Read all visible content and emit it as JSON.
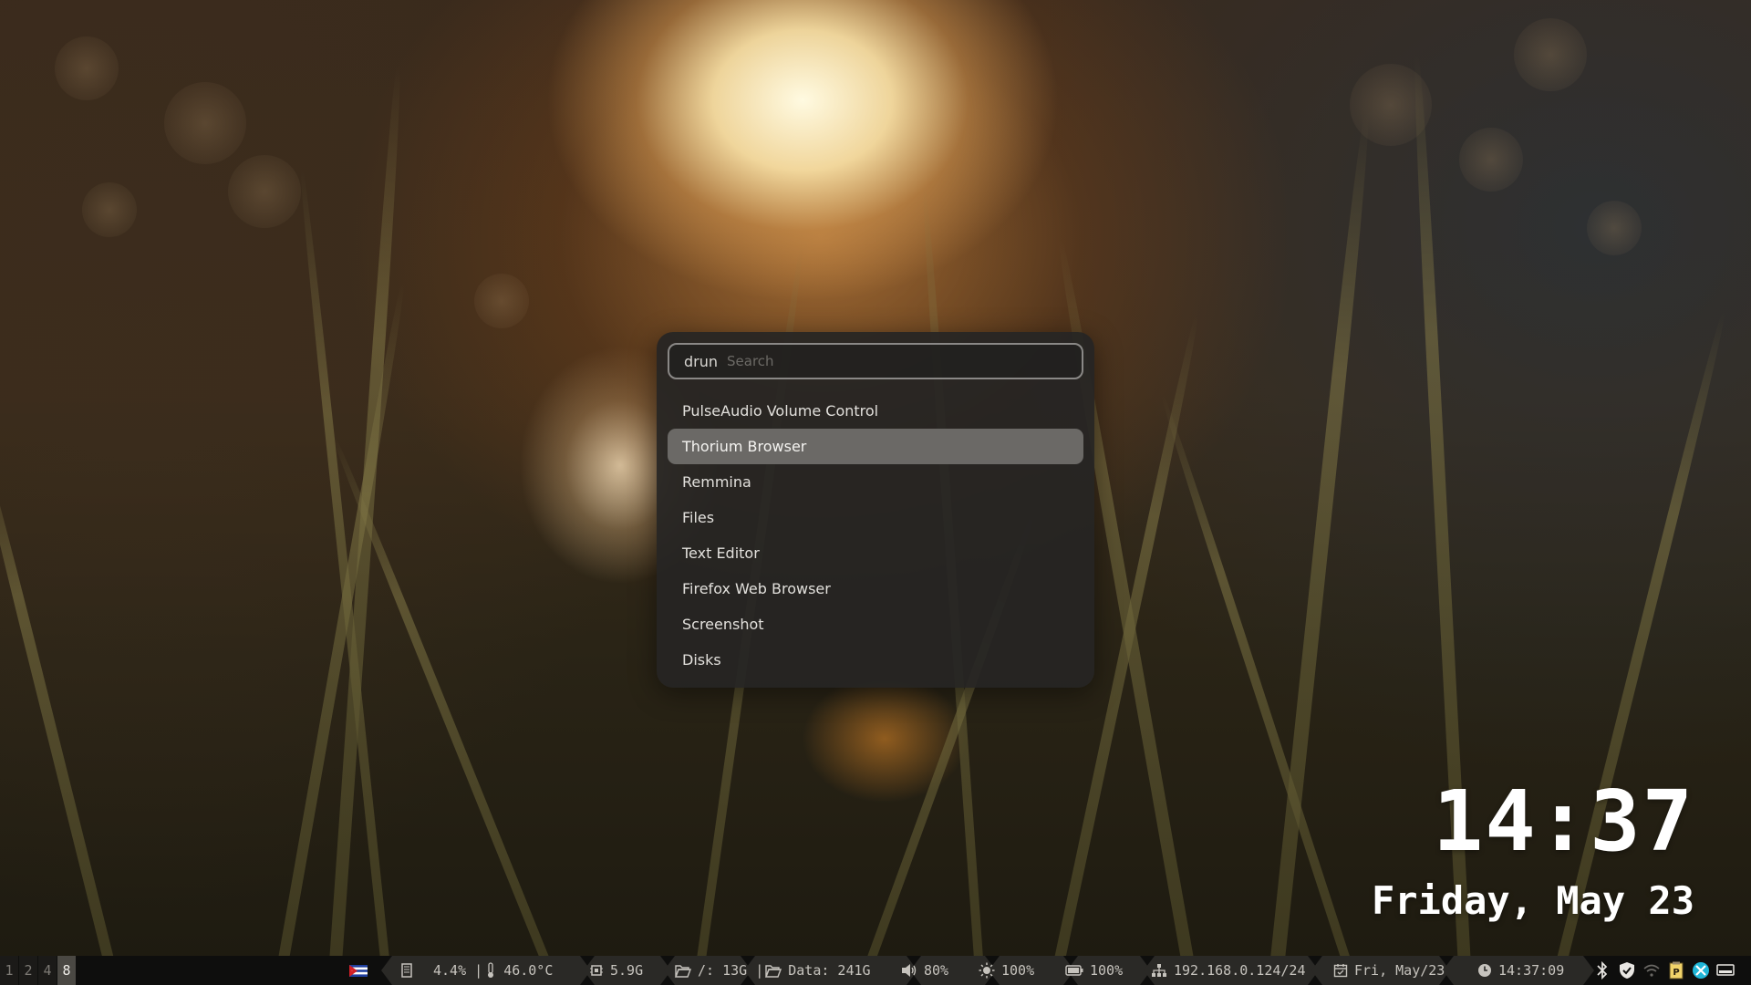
{
  "launcher": {
    "mode": "drun",
    "search_placeholder": "Search",
    "search_value": "",
    "selected_index": 1,
    "items": [
      {
        "label": "PulseAudio Volume Control"
      },
      {
        "label": "Thorium Browser"
      },
      {
        "label": "Remmina"
      },
      {
        "label": "Files"
      },
      {
        "label": "Text Editor"
      },
      {
        "label": "Firefox Web Browser"
      },
      {
        "label": "Screenshot"
      },
      {
        "label": "Disks"
      }
    ]
  },
  "desktop_clock": {
    "time": "14:37",
    "date": "Friday, May 23"
  },
  "bar": {
    "workspaces": [
      {
        "label": "1",
        "active": false
      },
      {
        "label": "2",
        "active": false
      },
      {
        "label": "4",
        "active": false
      },
      {
        "label": "8",
        "active": true
      }
    ],
    "cpu": "4.4% | ",
    "temperature": "46.0°C",
    "memory": "5.9G",
    "root_disk": "/: 13G | ",
    "data_disk": "Data: 241G",
    "volume": "80%",
    "brightness": "100%",
    "battery": "100%",
    "network": "192.168.0.124/24",
    "date": "Fri, May/23",
    "time": "14:37:09",
    "colors": {
      "segment_bg": "#2a2926",
      "bar_bg": "#0e0e0d",
      "text": "#c6c3bd"
    },
    "tray_icons": [
      "bluetooth-icon",
      "shield-icon",
      "wifi-icon",
      "parcellite-icon",
      "proton-icon",
      "display-icon"
    ]
  }
}
